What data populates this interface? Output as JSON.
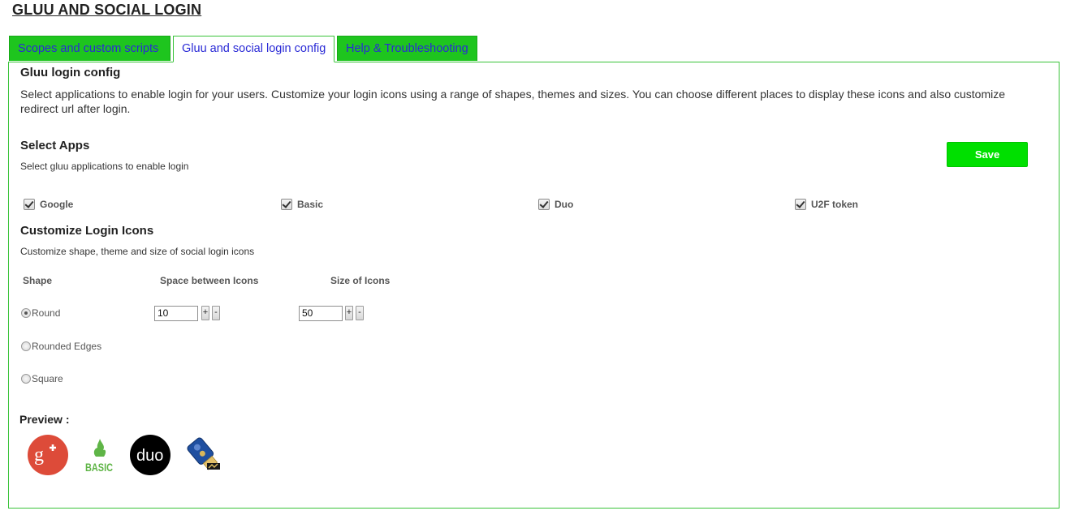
{
  "page": {
    "title": "GLUU AND SOCIAL LOGIN"
  },
  "tabs": [
    {
      "label": "Scopes and custom scripts",
      "active": false
    },
    {
      "label": "Gluu and social login config",
      "active": true
    },
    {
      "label": "Help & Troubleshooting",
      "active": false
    }
  ],
  "config": {
    "heading": "Gluu login config",
    "description_line1": "Select applications to enable login for your users. Customize your login icons using a range of shapes, themes and sizes. You can choose different places to display these icons and also customize",
    "description_line2": "redirect url after login."
  },
  "select_apps": {
    "heading": "Select Apps",
    "subtext": "Select gluu applications to enable login",
    "save_label": "Save",
    "apps": [
      {
        "label": "Google",
        "checked": true
      },
      {
        "label": "Basic",
        "checked": true
      },
      {
        "label": "Duo",
        "checked": true
      },
      {
        "label": "U2F token",
        "checked": true
      }
    ]
  },
  "customize": {
    "heading": "Customize Login Icons",
    "subtext": "Customize shape, theme and size of social login icons",
    "shape_header": "Shape",
    "space_header": "Space between Icons",
    "size_header": "Size of Icons",
    "shapes": [
      {
        "label": "Round",
        "selected": true
      },
      {
        "label": "Rounded Edges",
        "selected": false
      },
      {
        "label": "Square",
        "selected": false
      }
    ],
    "space_value": "10",
    "size_value": "50",
    "plus": "+",
    "minus": "-"
  },
  "preview": {
    "label": "Preview :",
    "icons": [
      "google-plus-icon",
      "basic-icon",
      "duo-icon",
      "u2f-token-icon"
    ],
    "basic_text": "BASIC",
    "duo_text": "duo",
    "colors": {
      "google": "#dd4b39",
      "basic": "#5fb547",
      "duo": "#000000",
      "u2f": "#1f4fa0"
    }
  },
  "theme": {
    "tab_green": "#1ec51e",
    "save_green": "#00e000",
    "border_green": "#39c339",
    "link_blue": "#2a2ad6"
  }
}
